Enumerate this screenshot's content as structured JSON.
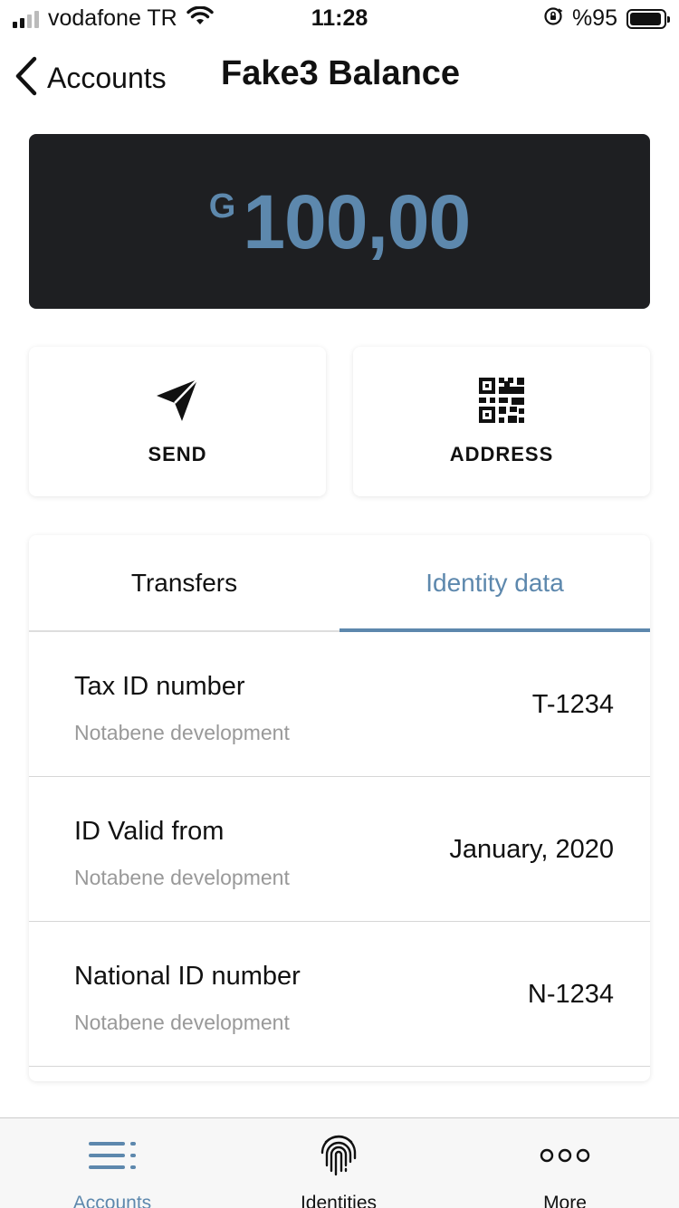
{
  "status_bar": {
    "carrier": "vodafone TR",
    "time": "11:28",
    "battery_pct": "%95",
    "battery_level": 0.95
  },
  "nav": {
    "back_label": "Accounts",
    "title": "Fake3 Balance"
  },
  "balance": {
    "currency_symbol": "G",
    "amount": "100,00",
    "accent_color": "#5d88ad"
  },
  "actions": {
    "send_label": "SEND",
    "send_icon": "paper-plane-icon",
    "address_label": "ADDRESS",
    "address_icon": "qr-code-icon"
  },
  "tabs": [
    {
      "label": "Transfers",
      "active": false
    },
    {
      "label": "Identity data",
      "active": true
    }
  ],
  "identity_rows": [
    {
      "label": "Tax ID number",
      "source": "Notabene development",
      "value": "T-1234"
    },
    {
      "label": "ID Valid from",
      "source": "Notabene development",
      "value": "January, 2020"
    },
    {
      "label": "National ID number",
      "source": "Notabene development",
      "value": "N-1234"
    }
  ],
  "tab_bar": [
    {
      "label": "Accounts",
      "icon": "menu-lines-icon",
      "active": true
    },
    {
      "label": "Identities",
      "icon": "fingerprint-icon",
      "active": false
    },
    {
      "label": "More",
      "icon": "more-dots-icon",
      "active": false
    }
  ]
}
